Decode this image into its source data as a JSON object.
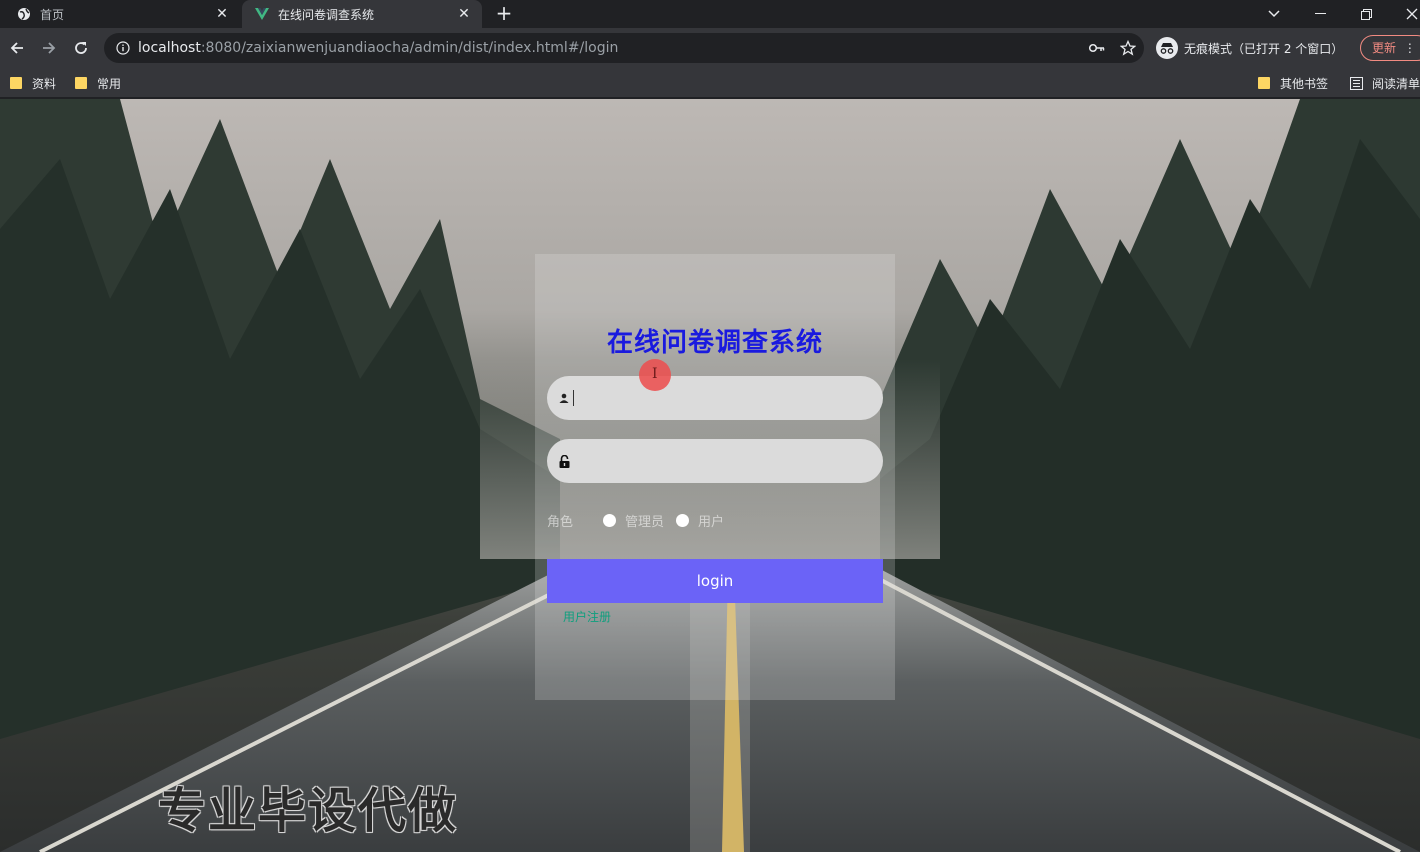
{
  "browser": {
    "tabs": [
      {
        "title": "首页",
        "icon": "globe-icon"
      },
      {
        "title": "在线问卷调查系统",
        "icon": "vue-logo-icon"
      }
    ],
    "url": {
      "host": "localhost",
      "rest": ":8080/zaixianwenjuandiaocha/admin/dist/index.html#/login"
    },
    "incognito_label": "无痕模式（已打开 2 个窗口）",
    "update_label": "更新",
    "bookmarks": [
      {
        "label": "资料",
        "icon": "folder-icon"
      },
      {
        "label": "常用",
        "icon": "folder-icon"
      },
      {
        "label": "其他书签",
        "icon": "folder-icon"
      },
      {
        "label": "阅读清单",
        "icon": "reading-list-icon"
      }
    ]
  },
  "login": {
    "title": "在线问卷调查系统",
    "username_value": "",
    "password_value": "",
    "role_label": "角色",
    "roles": [
      "管理员",
      "用户"
    ],
    "submit_label": "login",
    "register_link": "用户注册"
  },
  "overlay": {
    "watermark": "专业毕设代做",
    "cursor_glyph": "I"
  },
  "colors": {
    "title": "#1a1adf",
    "login_button": "#6b63f7",
    "register_link": "#0e9f7e",
    "click_marker": "#ec5050"
  }
}
